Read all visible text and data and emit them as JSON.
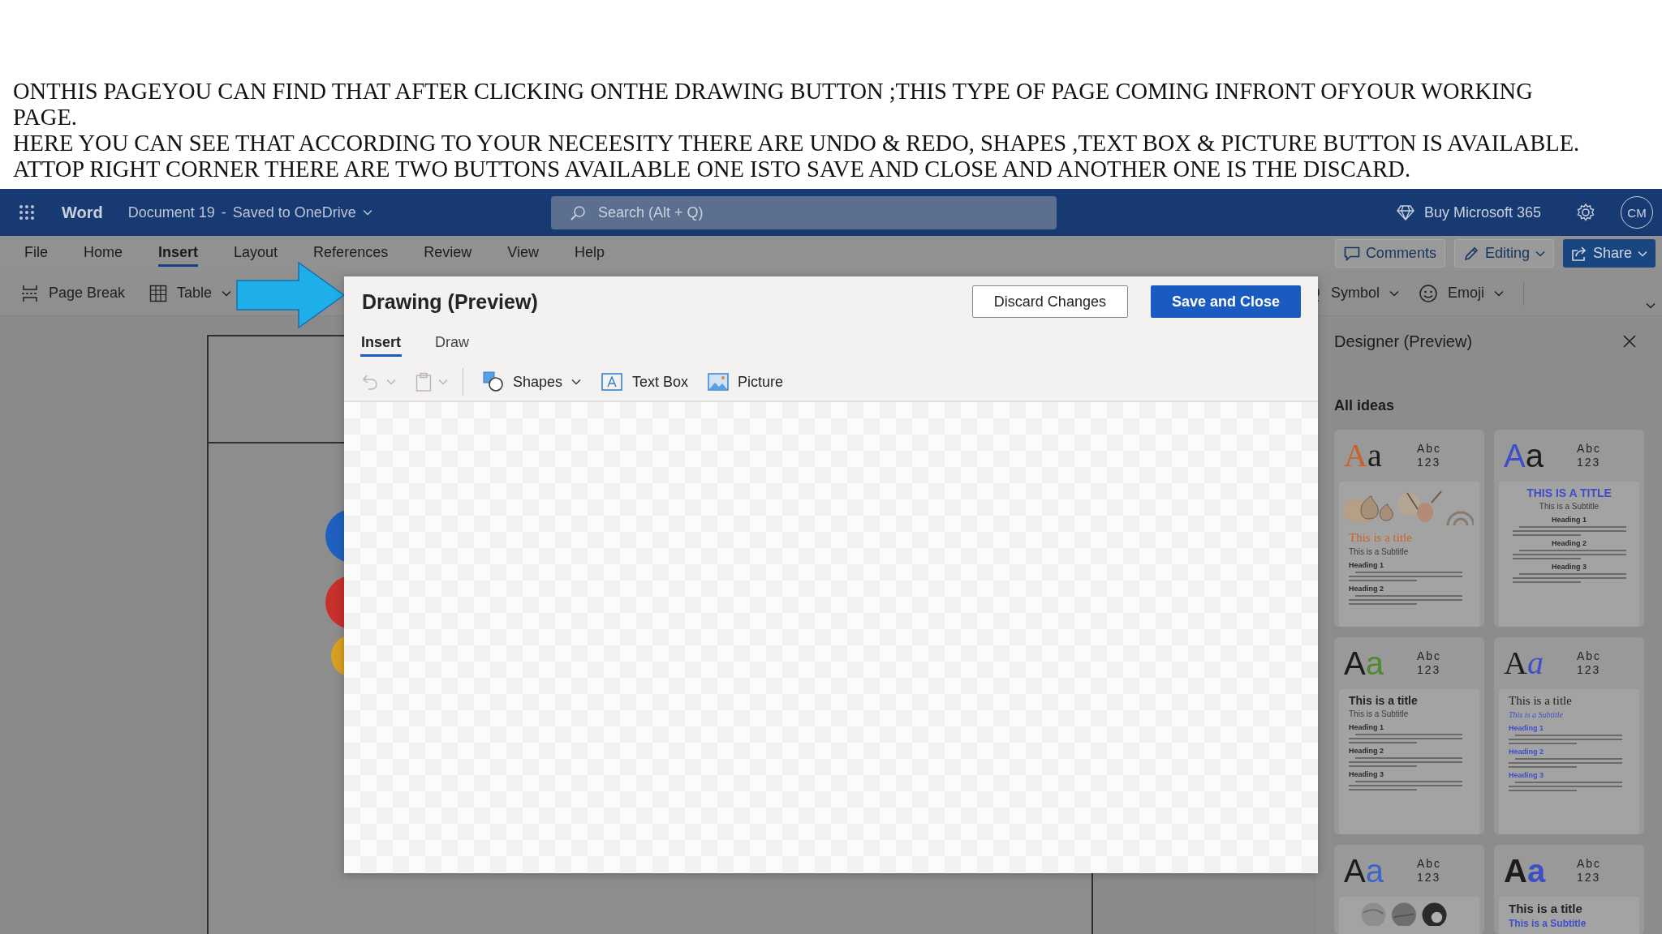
{
  "caption": {
    "lines": [
      "ONTHIS PAGEYOU CAN FIND THAT AFTER CLICKING ONTHE DRAWING BUTTON ;THIS TYPE OF PAGE COMING INFRONT OFYOUR WORKING PAGE.",
      "HERE YOU CAN SEE THAT ACCORDING TO YOUR NECEESITY THERE ARE UNDO & REDO, SHAPES ,TEXT BOX & PICTURE BUTTON IS AVAILABLE.",
      "ATTOP RIGHT CORNER THERE ARE TWO BUTTONS AVAILABLE ONE ISTO SAVE AND CLOSE AND ANOTHER ONE IS THE DISCARD."
    ]
  },
  "header": {
    "app_name": "Word",
    "document": "Document 19",
    "separator": "-",
    "save_status": "Saved to OneDrive",
    "search": {
      "placeholder": "Search (Alt + Q)"
    },
    "buy": "Buy Microsoft 365",
    "avatar": "CM"
  },
  "ribbon": {
    "tabs": [
      {
        "label": "File",
        "selected": false
      },
      {
        "label": "Home",
        "selected": false
      },
      {
        "label": "Insert",
        "selected": true
      },
      {
        "label": "Layout",
        "selected": false
      },
      {
        "label": "References",
        "selected": false
      },
      {
        "label": "Review",
        "selected": false
      },
      {
        "label": "View",
        "selected": false
      },
      {
        "label": "Help",
        "selected": false
      }
    ],
    "actions": [
      {
        "label": "Comments",
        "kind": "outline",
        "dropdown": false
      },
      {
        "label": "Editing",
        "kind": "outline",
        "dropdown": true
      },
      {
        "label": "Share",
        "kind": "primary",
        "dropdown": true
      }
    ],
    "tools_left": [
      {
        "label": "Page Break",
        "dropdown": false
      },
      {
        "label": "Table",
        "dropdown": true
      }
    ],
    "tools_right": [
      {
        "label": "Symbol",
        "dropdown": true
      },
      {
        "label": "Emoji",
        "dropdown": true
      }
    ]
  },
  "drawing_dialog": {
    "title": "Drawing (Preview)",
    "buttons": [
      {
        "label": "Discard Changes",
        "kind": "secondary"
      },
      {
        "label": "Save and Close",
        "kind": "primary"
      }
    ],
    "tabs": [
      {
        "label": "Insert",
        "selected": true
      },
      {
        "label": "Draw",
        "selected": false
      }
    ],
    "tools": [
      {
        "disabled": true,
        "dropdown": true
      },
      {
        "disabled": true,
        "dropdown": true
      },
      {
        "label": "Shapes",
        "disabled": false,
        "dropdown": true,
        "separator_before": true
      },
      {
        "label": "Text Box",
        "disabled": false,
        "dropdown": false
      },
      {
        "label": "Picture",
        "disabled": false,
        "dropdown": false
      }
    ]
  },
  "designer": {
    "title": "Designer (Preview)",
    "section": "All ideas",
    "cards": [
      {
        "kind": "illustrated",
        "upper": "A",
        "lower": "a",
        "color": "#c8622a",
        "abc": "Abc",
        "num": "123",
        "title": "This is a title",
        "subtitle": "This is a Subtitle",
        "headings": [
          "Heading 1",
          "Heading 2"
        ]
      },
      {
        "kind": "centered",
        "upper": "A",
        "lower": "a",
        "color": "#3d4fc8",
        "abc": "Abc",
        "num": "123",
        "title": "THIS IS A TITLE",
        "subtitle": "This is a Subtitle",
        "headings": [
          "Heading 1",
          "Heading 2",
          "Heading 3"
        ]
      },
      {
        "kind": "plain",
        "upper": "A",
        "lower": "a",
        "color": "#4f8a2e",
        "abc": "Abc",
        "num": "123",
        "title": "This is a title",
        "subtitle": "This is a Subtitle",
        "headings": [
          "Heading 1",
          "Heading 2",
          "Heading 3"
        ]
      },
      {
        "kind": "classic",
        "upper": "A",
        "lower": "a",
        "color": "#3d4fc8",
        "abc": "Abc",
        "num": "123",
        "title": "This is a title",
        "subtitle": "This is a Subtitle",
        "headings": [
          "Heading 1",
          "Heading 2",
          "Heading 3"
        ]
      },
      {
        "kind": "photos",
        "upper": "A",
        "lower": "a",
        "color": "#3b64cc",
        "abc": "Abc",
        "num": "123"
      },
      {
        "kind": "bold",
        "upper": "A",
        "lower": "a",
        "color": "#3d4fc8",
        "abc": "Abc",
        "num": "123",
        "title": "This is a title",
        "subtitle": "This is a Subtitle"
      }
    ]
  }
}
